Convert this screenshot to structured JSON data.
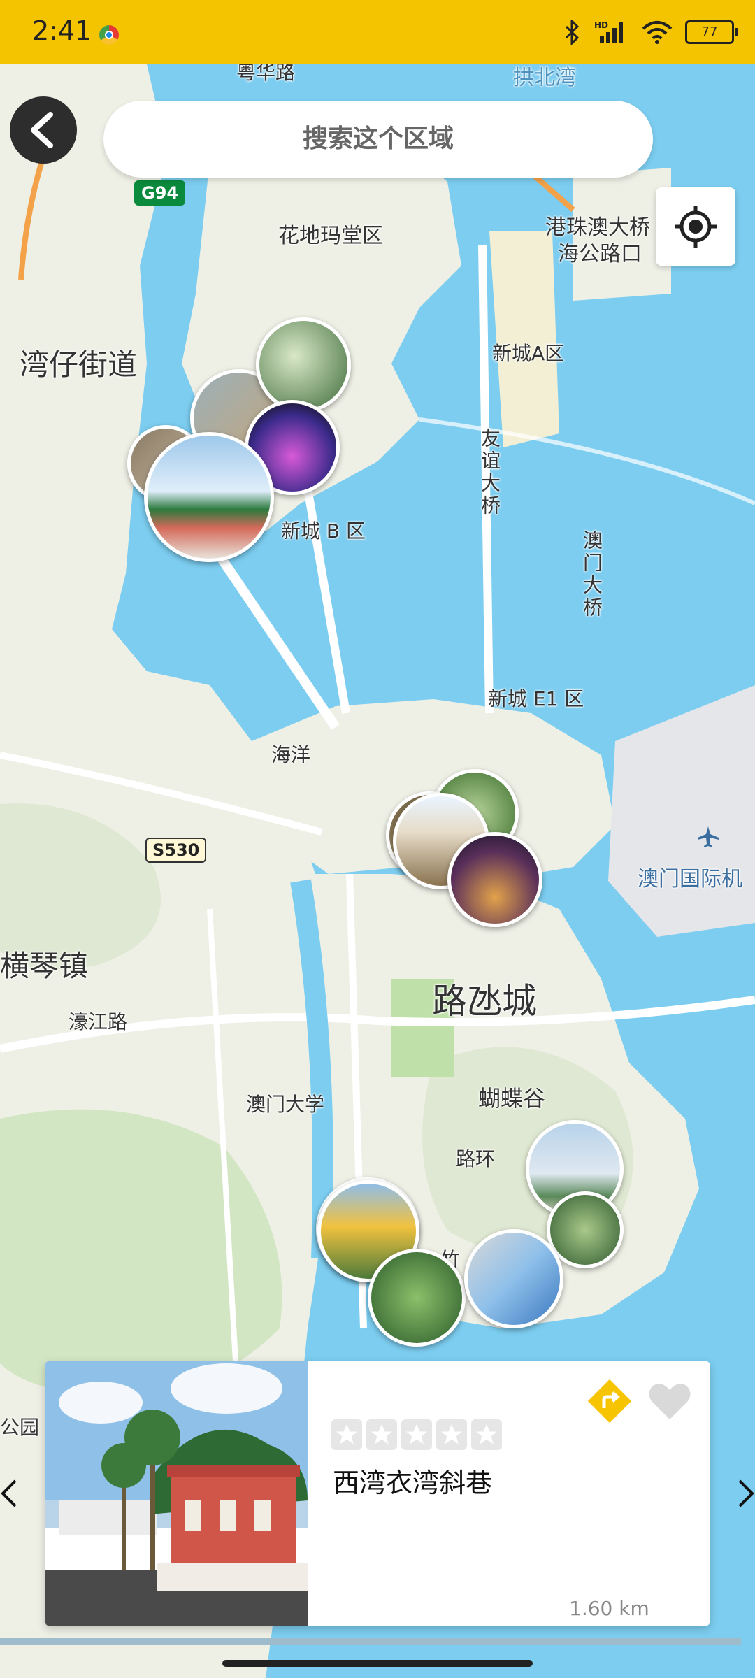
{
  "status": {
    "time": "2:41",
    "battery": "77"
  },
  "search": {
    "label": "搜索这个区域"
  },
  "map": {
    "labels": {
      "yuehua": "粤华路",
      "gongbei": "拱北湾",
      "huadi": "花地玛堂区",
      "hzm": "港珠澳大桥",
      "hzm2": "海公路口",
      "wanzai": "湾仔街道",
      "xincheng_a": "新城A区",
      "youyi": "友谊大桥",
      "xincheng_b": "新城 B 区",
      "aomen_bridge": "澳门大桥",
      "xincheng_e1": "新城 E1 区",
      "haiyang": "海洋",
      "airport": "澳门国际机",
      "hengqin": "横琴镇",
      "luhuan_city": "路氹城",
      "haojiang": "濠江路",
      "umac": "澳门大学",
      "butterfly": "蝴蝶谷",
      "luhuan": "路环",
      "park": "公园",
      "zhu": "竹"
    },
    "shields": {
      "g94": "G94",
      "s530": "S530"
    }
  },
  "card": {
    "title": "西湾衣湾斜巷",
    "distance": "1.60 km",
    "rating": 0
  },
  "icons": {
    "back": "chevron-left-icon",
    "locate": "crosshair-icon",
    "directions": "directions-icon",
    "favorite": "heart-icon",
    "prev": "chevron-left-icon",
    "next": "chevron-right-icon"
  },
  "colors": {
    "status_bar": "#f5c400",
    "water": "#7ccdf0",
    "land": "#eef0e6",
    "accent": "#f6c400"
  }
}
